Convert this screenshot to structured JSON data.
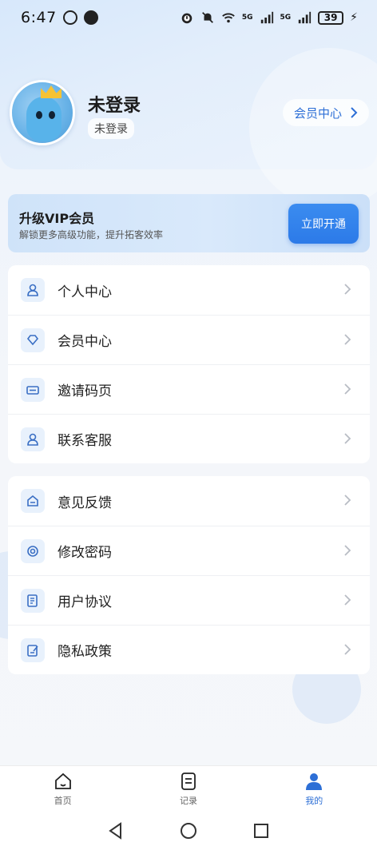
{
  "status_bar": {
    "time": "6:47",
    "battery": "39",
    "network_1": "5G",
    "network_2": "5G"
  },
  "profile": {
    "name": "未登录",
    "badge": "未登录",
    "member_center_label": "会员中心"
  },
  "vip": {
    "title": "升级VIP会员",
    "subtitle": "解锁更多高级功能，提升拓客效率",
    "button_label": "立即开通"
  },
  "menu_group_1": [
    {
      "label": "个人中心",
      "icon": "person-icon"
    },
    {
      "label": "会员中心",
      "icon": "diamond-icon"
    },
    {
      "label": "邀请码页",
      "icon": "ticket-icon"
    },
    {
      "label": "联系客服",
      "icon": "support-icon"
    }
  ],
  "menu_group_2": [
    {
      "label": "意见反馈",
      "icon": "mail-icon"
    },
    {
      "label": "修改密码",
      "icon": "lock-ring-icon"
    },
    {
      "label": "用户协议",
      "icon": "document-icon"
    },
    {
      "label": "隐私政策",
      "icon": "edit-document-icon"
    }
  ],
  "bottom_nav": [
    {
      "label": "首页",
      "icon": "home-icon",
      "active": false
    },
    {
      "label": "记录",
      "icon": "record-icon",
      "active": false
    },
    {
      "label": "我的",
      "icon": "profile-icon",
      "active": true
    }
  ],
  "colors": {
    "accent": "#2d6fd6",
    "vip_button": "#2c7ae8",
    "icon_bg": "#e8f1fc",
    "icon_stroke": "#3a6fc4"
  }
}
